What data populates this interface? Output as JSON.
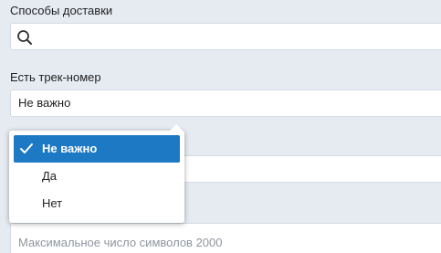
{
  "delivery": {
    "label": "Способы доставки",
    "search_value": ""
  },
  "tracking": {
    "label": "Есть трек-номер",
    "selected_value": "Не важно",
    "options": [
      {
        "label": "Не важно",
        "selected": true
      },
      {
        "label": "Да",
        "selected": false
      },
      {
        "label": "Нет",
        "selected": false
      }
    ]
  },
  "comment": {
    "placeholder": "Максимальное число символов 2000"
  },
  "colors": {
    "background": "#e6ebf2",
    "accent": "#1d79c3"
  },
  "icons": {
    "search": "search-icon",
    "check": "check-icon"
  }
}
